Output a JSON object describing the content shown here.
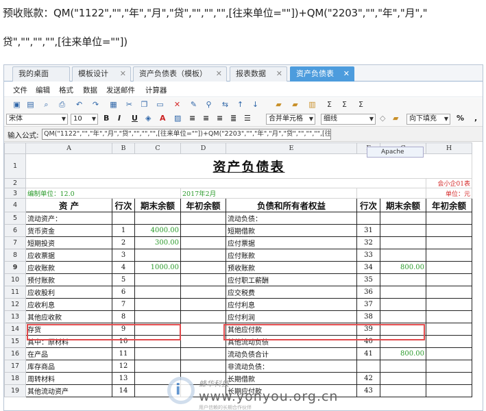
{
  "caption": {
    "line1": "预收账款：QM(\"1122\",\"\",\"年\",\"月\",\"贷\",\"\",\"\",\"\",[往来单位=\"\"])+QM(\"2203\",\"\",\"年\",\"月\",\"",
    "line2": "贷\",\"\",\"\",\"\",[往来单位=\"\"])"
  },
  "tabs": [
    {
      "label": "我的桌面"
    },
    {
      "label": "模板设计"
    },
    {
      "label": "资产负债表（模板）"
    },
    {
      "label": "报表数据"
    },
    {
      "label": "资产负债表",
      "active": true
    }
  ],
  "menu": [
    "文件",
    "编辑",
    "格式",
    "数据",
    "发送邮件",
    "计算器"
  ],
  "toolbar": {
    "font": "宋体",
    "size": "10",
    "merge": "合并单元格",
    "border": "细线",
    "fill": "向下填充",
    "percent": "%"
  },
  "formula": {
    "label": "输入公式:",
    "value": "QM(\"1122\",\"\",\"年\",\"月\",\"贷\",\"\",\"\",\"\",[往来单位=\"\"])+QM(\"2203\",\"\",\"年\",\"月\",\"贷\",\"\",\"\",\"\",[往来单位=\"\"]"
  },
  "tooltip": "Apache",
  "columns": [
    "",
    "A",
    "B",
    "C",
    "D",
    "E",
    "F",
    "G",
    "H"
  ],
  "sheet": {
    "title": "资产负债表",
    "code": "会小企01表",
    "unit": "单位：元",
    "org": "编制单位：12.0",
    "period": "2017年2月",
    "headers": [
      "资      产",
      "行次",
      "期末余额",
      "年初余额",
      "负债和所有者权益",
      "行次",
      "期末余额",
      "年初余额"
    ],
    "rows": [
      {
        "n": "5",
        "a": "流动资产：",
        "b": "",
        "c": "",
        "e": "流动负债：",
        "f": "",
        "g": ""
      },
      {
        "n": "6",
        "a": "货币资金",
        "b": "1",
        "c": "4000.00",
        "e": "短期借款",
        "f": "31",
        "g": ""
      },
      {
        "n": "7",
        "a": "短期投资",
        "b": "2",
        "c": "300.00",
        "e": "应付票据",
        "f": "32",
        "g": ""
      },
      {
        "n": "8",
        "a": "应收票据",
        "b": "3",
        "c": "",
        "e": "应付账款",
        "f": "33",
        "g": ""
      },
      {
        "n": "9",
        "a": "应收账款",
        "b": "4",
        "c": "1000.00",
        "e": "预收账款",
        "f": "34",
        "g": "800.00"
      },
      {
        "n": "10",
        "a": "预付账款",
        "b": "5",
        "c": "",
        "e": "应付职工薪酬",
        "f": "35",
        "g": ""
      },
      {
        "n": "11",
        "a": "应收股利",
        "b": "6",
        "c": "",
        "e": "应交税费",
        "f": "36",
        "g": ""
      },
      {
        "n": "12",
        "a": "应收利息",
        "b": "7",
        "c": "",
        "e": "应付利息",
        "f": "37",
        "g": ""
      },
      {
        "n": "13",
        "a": "其他应收款",
        "b": "8",
        "c": "",
        "e": "应付利润",
        "f": "38",
        "g": ""
      },
      {
        "n": "14",
        "a": "存货",
        "b": "9",
        "c": "",
        "e": "其他应付款",
        "f": "39",
        "g": ""
      },
      {
        "n": "15",
        "a": "其中：原材料",
        "b": "10",
        "c": "",
        "e": "其他流动负债",
        "f": "40",
        "g": ""
      },
      {
        "n": "16",
        "a": "在产品",
        "b": "11",
        "c": "",
        "e": "流动负债合计",
        "f": "41",
        "g": "800.00"
      },
      {
        "n": "17",
        "a": "库存商品",
        "b": "12",
        "c": "",
        "e": "非流动负债：",
        "f": "",
        "g": ""
      },
      {
        "n": "18",
        "a": "周转材料",
        "b": "13",
        "c": "",
        "e": "长期借款",
        "f": "42",
        "g": ""
      },
      {
        "n": "19",
        "a": "其他流动资产",
        "b": "14",
        "c": "",
        "e": "长期应付款",
        "f": "43",
        "g": ""
      }
    ]
  },
  "watermark": {
    "line1": "蜂华科技",
    "line2": "www.yonyou.org.cn",
    "line3": "用户信赖的长期合作伙伴"
  },
  "colors": {
    "accent": "#4d9cdd",
    "highlight": "#e0484a",
    "green": "#2a9a2a",
    "red": "#d42a2a"
  }
}
